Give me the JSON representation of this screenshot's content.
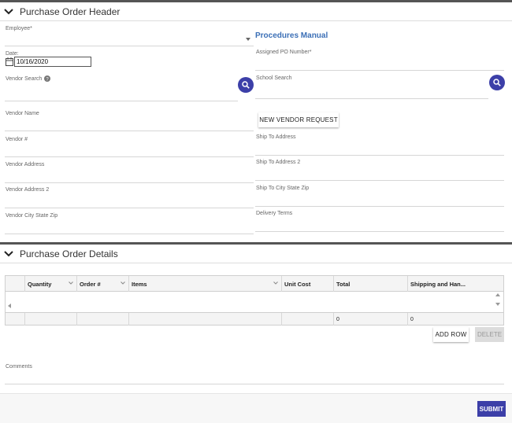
{
  "header_section": {
    "title": "Purchase Order Header"
  },
  "left_fields": {
    "employee_label": "Employee*",
    "date_label": "Date:",
    "date_value": "10/16/2020",
    "vendor_search_label": "Vendor Search",
    "vendor_name_label": "Vendor Name",
    "vendor_number_label": "Vendor #",
    "vendor_address_label": "Vendor Address",
    "vendor_address2_label": "Vendor Address 2",
    "vendor_city_label": "Vendor City State Zip"
  },
  "right_fields": {
    "procedures_link": "Procedures Manual",
    "assigned_po_label": "Assigned PO Number*",
    "school_search_label": "School Search",
    "new_vendor_button": "NEW VENDOR REQUEST",
    "ship_to_address_label": "Ship To Address",
    "ship_to_address2_label": "Ship To Address 2",
    "ship_to_city_label": "Ship To City State Zip",
    "delivery_terms_label": "Delivery Terms"
  },
  "details_section": {
    "title": "Purchase Order Details"
  },
  "grid": {
    "columns": [
      "",
      "Quantity",
      "Order #",
      "Items",
      "Unit Cost",
      "Total",
      "Shipping and Han..."
    ],
    "footer": [
      "",
      "",
      "",
      "",
      "",
      "0",
      "0"
    ]
  },
  "actions": {
    "add_row": "ADD ROW",
    "delete": "DELETE"
  },
  "comments_label": "Comments",
  "submit_label": "SUBMIT",
  "colors": {
    "accent": "#3c3fa8",
    "link": "#3b6fb6"
  }
}
